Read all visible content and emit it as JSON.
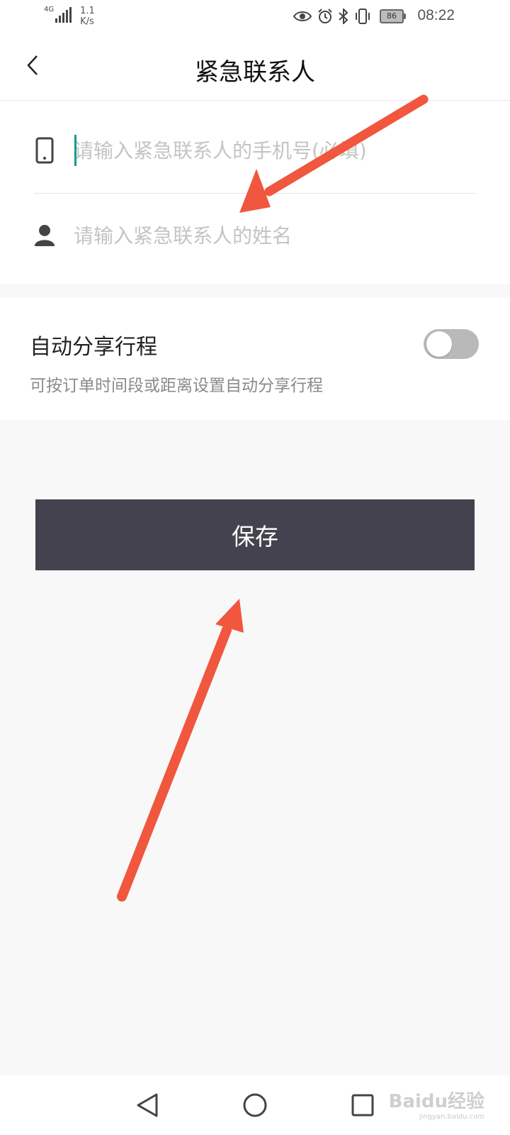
{
  "status_bar": {
    "network_type": "4G",
    "speed_value": "1.1",
    "speed_unit": "K/s",
    "battery_level": "86",
    "time": "08:22"
  },
  "header": {
    "title": "紧急联系人"
  },
  "form": {
    "phone_placeholder": "请输入紧急联系人的手机号(必填)",
    "name_placeholder": "请输入紧急联系人的姓名"
  },
  "auto_share": {
    "title": "自动分享行程",
    "description": "可按订单时间段或距离设置自动分享行程",
    "enabled": false
  },
  "save_label": "保存",
  "watermark": {
    "main": "Baidu经验",
    "sub": "jingyan.baidu.com"
  },
  "colors": {
    "save_button": "#45424f",
    "caret": "#129b8a",
    "annotation_arrow": "#f0573e",
    "toggle_off": "#b9b9b9"
  }
}
